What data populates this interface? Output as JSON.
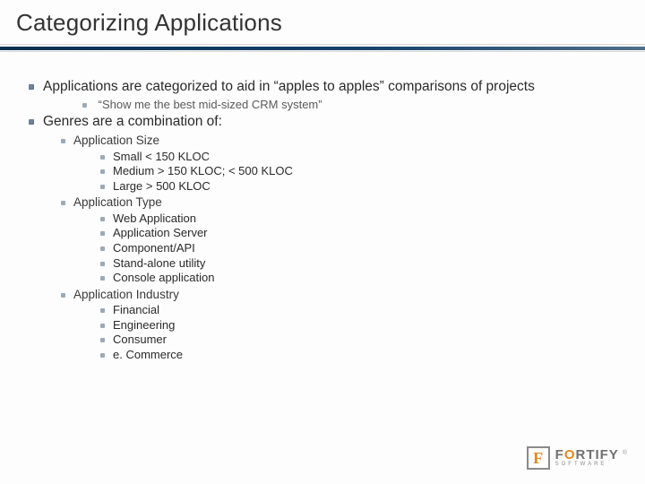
{
  "title": "Categorizing Applications",
  "bullets": {
    "b1": "Applications are categorized to aid in “apples to apples” comparisons of projects",
    "b1_sub": "“Show me the best mid-sized CRM system”",
    "b2": "Genres are a combination of:",
    "groups": [
      {
        "label": "Application Size",
        "items": [
          "Small < 150 KLOC",
          "Medium > 150 KLOC; < 500 KLOC",
          "Large > 500 KLOC"
        ]
      },
      {
        "label": "Application Type",
        "items": [
          "Web Application",
          "Application Server",
          "Component/API",
          "Stand-alone utility",
          "Console application"
        ]
      },
      {
        "label": "Application Industry",
        "items": [
          "Financial",
          "Engineering",
          "Consumer",
          "e. Commerce"
        ]
      }
    ]
  },
  "logo": {
    "mark": "F",
    "name_pre": "F",
    "name_o": "O",
    "name_post": "RTIFY",
    "sub": "SOFTWARE",
    "reg": "®"
  }
}
